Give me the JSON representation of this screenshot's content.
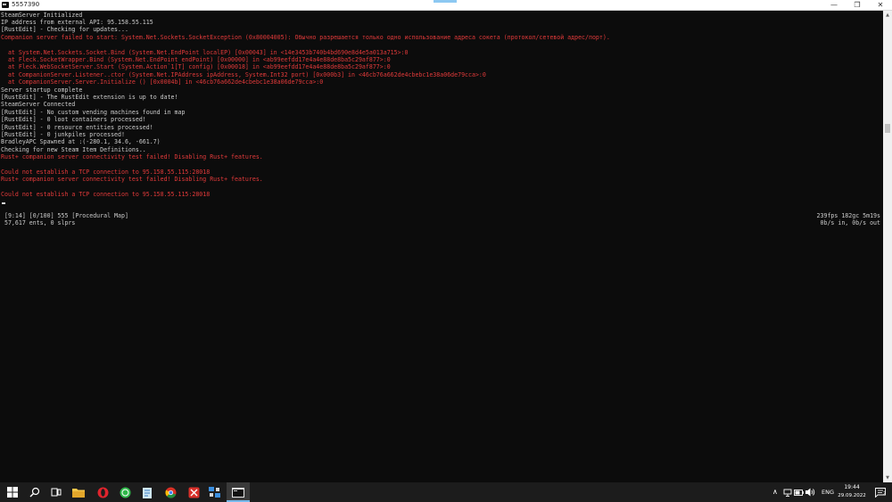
{
  "window": {
    "title": "5557390",
    "minimize_glyph": "—",
    "maximize_glyph": "❐",
    "close_glyph": "✕"
  },
  "console": {
    "lines": [
      {
        "text": "SteamServer Initialized",
        "kind": "normal"
      },
      {
        "text": "IP address from external API: 95.158.55.115",
        "kind": "normal"
      },
      {
        "text": "[RustEdit] - Checking for updates...",
        "kind": "normal"
      },
      {
        "text": "Companion server failed to start: System.Net.Sockets.SocketException (0x80004005): Обычно разрешается только одно использование адреса сокета (протокол/сетевой адрес/порт).",
        "kind": "error"
      },
      {
        "text": "",
        "kind": "normal"
      },
      {
        "text": "  at System.Net.Sockets.Socket.Bind (System.Net.EndPoint localEP) [0x00043] in <14e3453b740b4bd690e8d4e5a013a715>:0",
        "kind": "error"
      },
      {
        "text": "  at Fleck.SocketWrapper.Bind (System.Net.EndPoint endPoint) [0x00000] in <ab99eefdd17e4a4e88de8ba5c29af877>:0",
        "kind": "error"
      },
      {
        "text": "  at Fleck.WebSocketServer.Start (System.Action`1[T] config) [0x00018] in <ab99eefdd17e4a4e88de8ba5c29af877>:0",
        "kind": "error"
      },
      {
        "text": "  at CompanionServer.Listener..ctor (System.Net.IPAddress ipAddress, System.Int32 port) [0x000b3] in <46cb76a662de4cbebc1e38a06de79cca>:0",
        "kind": "error"
      },
      {
        "text": "  at CompanionServer.Server.Initialize () [0x0004b] in <46cb76a662de4cbebc1e38a06de79cca>:0",
        "kind": "error"
      },
      {
        "text": "Server startup complete",
        "kind": "normal"
      },
      {
        "text": "[RustEdit] - The RustEdit extension is up to date!",
        "kind": "normal"
      },
      {
        "text": "SteamServer Connected",
        "kind": "normal"
      },
      {
        "text": "[RustEdit] - No custom vending machines found in map",
        "kind": "normal"
      },
      {
        "text": "[RustEdit] - 0 loot containers processed!",
        "kind": "normal"
      },
      {
        "text": "[RustEdit] - 0 resource entities processed!",
        "kind": "normal"
      },
      {
        "text": "[RustEdit] - 0 junkpiles processed!",
        "kind": "normal"
      },
      {
        "text": "BradleyAPC Spawned at :(-280.1, 34.6, -661.7)",
        "kind": "normal"
      },
      {
        "text": "Checking for new Steam Item Definitions..",
        "kind": "normal"
      },
      {
        "text": "Rust+ companion server connectivity test failed! Disabling Rust+ features.",
        "kind": "error"
      },
      {
        "text": "",
        "kind": "normal"
      },
      {
        "text": "Could not establish a TCP connection to 95.158.55.115:28018",
        "kind": "error"
      },
      {
        "text": "Rust+ companion server connectivity test failed! Disabling Rust+ features.",
        "kind": "error"
      },
      {
        "text": "",
        "kind": "normal"
      },
      {
        "text": "Could not establish a TCP connection to 95.158.55.115:28018",
        "kind": "error"
      }
    ],
    "status": {
      "left_line1": " [9:14] [0/100] 555 [Procedural Map]",
      "left_line2": " 57,617 ents, 0 slprs",
      "right_line1": "239fps 182gc 5m19s",
      "right_line2": "0b/s in, 0b/s out"
    }
  },
  "scrollbar": {
    "up_glyph": "▲",
    "down_glyph": "▼"
  },
  "taskbar": {
    "language": "ENG",
    "time": "19:44",
    "date": "29.09.2022",
    "notification_count": "2",
    "tray_chevron": "∧",
    "colors": {
      "taskbar_bg": "#1c1c1c",
      "active_indicator": "#76b9ed",
      "error_text": "#e23a3a"
    }
  }
}
